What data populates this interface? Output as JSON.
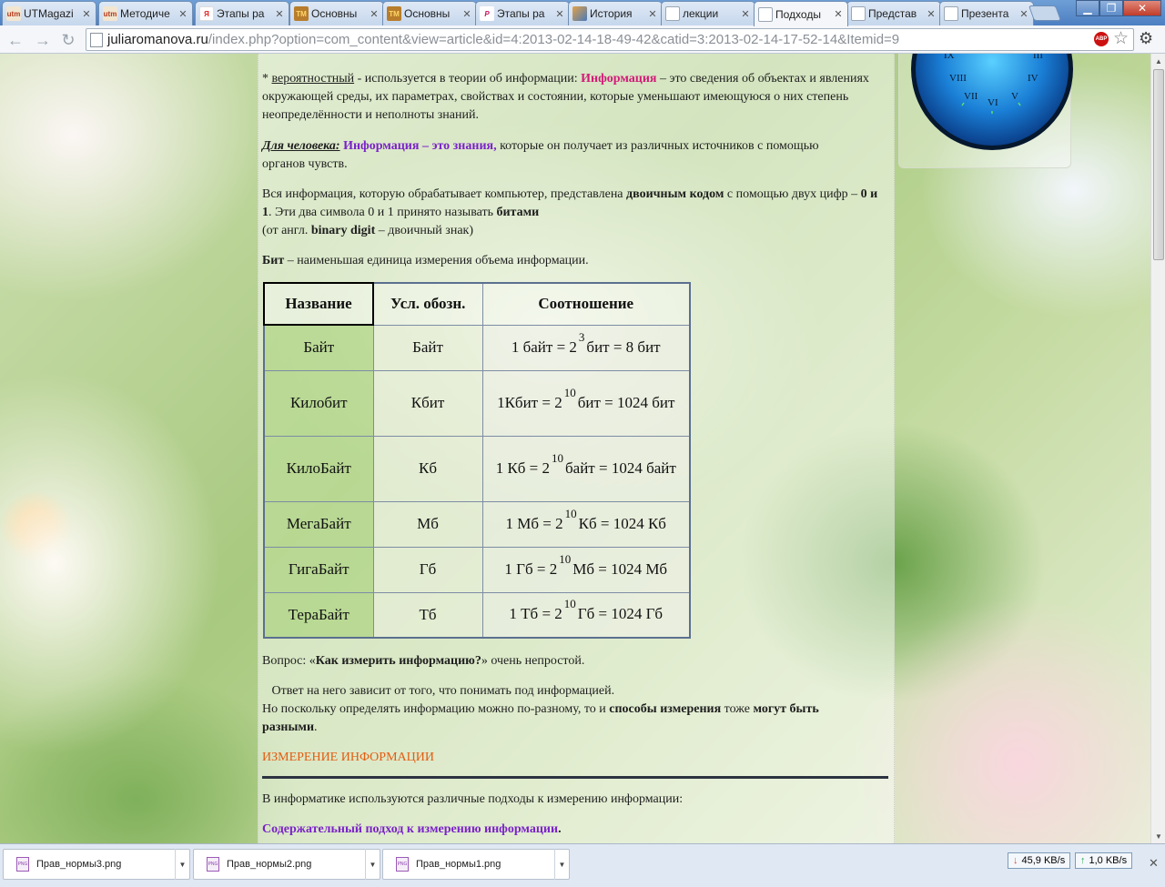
{
  "browser": {
    "tabs": [
      {
        "label": "UTMagazi",
        "favicon": "utm-favicon",
        "favicon_text": "utm",
        "active": false
      },
      {
        "label": "Методиче",
        "favicon": "utm-favicon",
        "favicon_text": "utm",
        "active": false
      },
      {
        "label": "Этапы ра",
        "favicon": "yandex-favicon",
        "favicon_text": "Я",
        "active": false
      },
      {
        "label": "Основны",
        "favicon": "book-favicon",
        "favicon_text": "TM",
        "active": false
      },
      {
        "label": "Основны",
        "favicon": "book-favicon",
        "favicon_text": "TM",
        "active": false
      },
      {
        "label": "Этапы ра",
        "favicon": "p-favicon",
        "favicon_text": "P",
        "active": false
      },
      {
        "label": "История",
        "favicon": "image-favicon",
        "favicon_text": "",
        "active": false
      },
      {
        "label": "лекции",
        "favicon": "page-favicon",
        "favicon_text": "",
        "active": false
      },
      {
        "label": "Подходы",
        "favicon": "page-favicon",
        "favicon_text": "",
        "active": true
      },
      {
        "label": "Представ",
        "favicon": "page-favicon",
        "favicon_text": "",
        "active": false
      },
      {
        "label": "Презента",
        "favicon": "page-favicon",
        "favicon_text": "",
        "active": false
      }
    ],
    "url_host": "juliaromanova.ru",
    "url_path": "/index.php?option=com_content&view=article&id=4:2013-02-14-18-49-42&catid=3:2013-02-14-17-52-14&Itemid=9",
    "abp_text": "ABP"
  },
  "clock": {
    "numerals": [
      "IX",
      "VIII",
      "VII",
      "VI",
      "V",
      "IV",
      "III"
    ]
  },
  "article": {
    "p1": {
      "bullet": "* ",
      "term": "вероятностный",
      "t1": "  - используется в теории об информации: ",
      "highlight": "Информация",
      "t2": " – это сведения об объектах и явлениях окружающей среды, их параметрах, свойствах и состоянии, которые уменьшают имеющуюся о них степень неопределённости и неполноты знаний."
    },
    "p2": {
      "lead": "Для человека:",
      "highlight": "Информация – это знания,",
      "rest": " которые он получает из различных источников с помощью органов чувств."
    },
    "p3": {
      "t1": "Вся информация, которую обрабатывает компьютер, представлена ",
      "b1": "двоичным кодом",
      "t2": " с помощью двух цифр – ",
      "b2": "0 и 1",
      "t3": ". Эти два символа 0 и 1 принято называть ",
      "b3": "битами",
      "t4": "(от англ. ",
      "b4": "binary digit",
      "t5": " – двоичный знак)"
    },
    "p4": {
      "b1": "Бит",
      "rest": " – наименьшая единица измерения объема информации."
    },
    "table": {
      "headers": [
        "Название",
        "Усл. обозн.",
        "Соотношение"
      ],
      "rows": [
        {
          "name": "Байт",
          "abbr": "Байт",
          "pre": "1 байт = 2",
          "exp": "3",
          "post": "бит = 8 бит"
        },
        {
          "name": "Килобит",
          "abbr": "Кбит",
          "pre": "1Кбит = 2",
          "exp": "10",
          "post": "бит = 1024 бит"
        },
        {
          "name": "КилоБайт",
          "abbr": "Кб",
          "pre": "1 Кб = 2",
          "exp": "10",
          "post": "байт = 1024 байт"
        },
        {
          "name": "МегаБайт",
          "abbr": "Мб",
          "pre": "1 Мб = 2",
          "exp": "10",
          "post": "Кб = 1024 Кб"
        },
        {
          "name": "ГигаБайт",
          "abbr": "Гб",
          "pre": "1 Гб = 2",
          "exp": "10",
          "post": "Мб = 1024 Мб"
        },
        {
          "name": "ТераБайт",
          "abbr": "Тб",
          "pre": "1 Тб = 2",
          "exp": "10",
          "post": "Гб = 1024 Гб"
        }
      ]
    },
    "p5": {
      "t1": "Вопрос: «",
      "b1": "Как измерить информацию?",
      "t2": "» очень непростой."
    },
    "p6": {
      "line1": "   Ответ на него зависит от того, что понимать под информацией.",
      "t1": "Но поскольку определять информацию можно по-разному, то и ",
      "b1": "способы измерения",
      "t2": " тоже ",
      "b2": "могут быть разными",
      "t3": "."
    },
    "heading": "ИЗМЕРЕНИЕ ИНФОРМАЦИИ",
    "p7": "В информатике используются различные подходы к измерению информации:",
    "p8": {
      "highlight": "Содержательный подход к измерению информации",
      "t": "."
    }
  },
  "downloads": {
    "items": [
      "Прав_нормы3.png",
      "Прав_нормы2.png",
      "Прав_нормы1.png"
    ],
    "file_badge": "PNG",
    "down_speed": "45,9 KB/s",
    "up_speed": "1,0 KB/s"
  },
  "colors": {
    "highlight_pink": "#d21a78",
    "highlight_purple": "#7a22c8",
    "heading_orange": "#e35d12",
    "clock_face": "#1a7fd6"
  }
}
